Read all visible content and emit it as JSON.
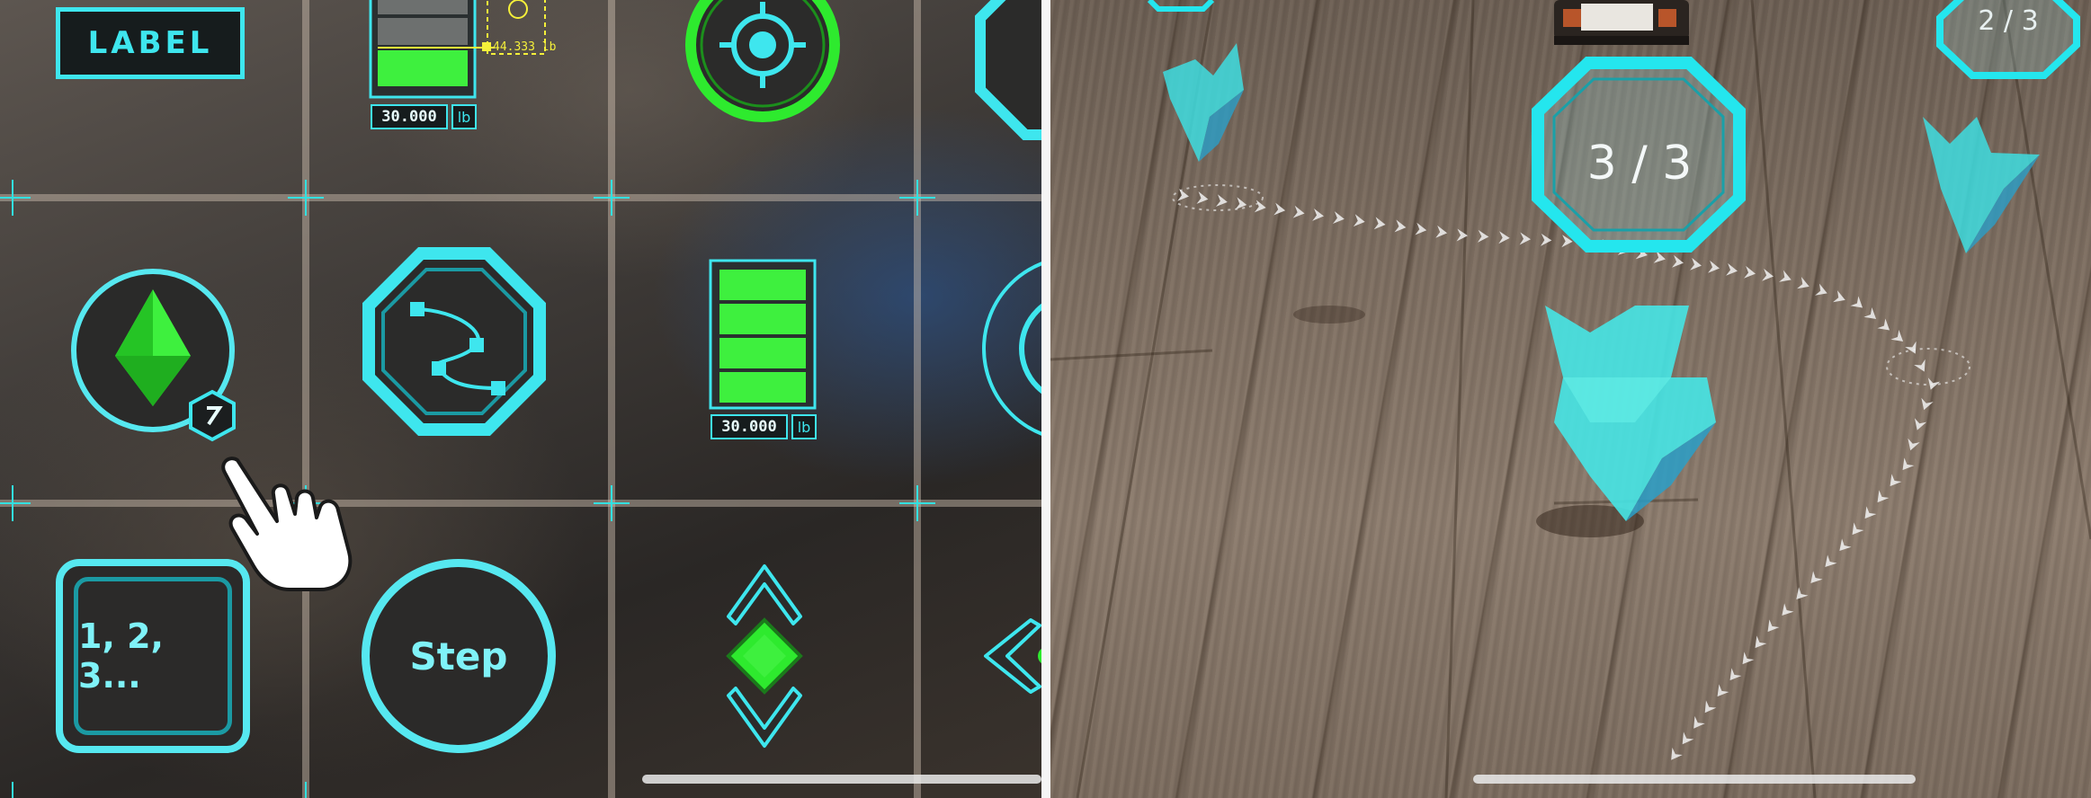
{
  "left": {
    "label_button": "LABEL",
    "weight_readout": "44.333 lb",
    "value_top": "30.000",
    "unit_top": "lb",
    "value_mid": "30.000",
    "unit_mid": "lb",
    "count_button": "1, 2, 3...",
    "step_button": "Step"
  },
  "right": {
    "waypoint_counter": "3 / 3",
    "waypoint_counter_far": "2 / 3"
  },
  "colors": {
    "cyan": "#3ee6ee",
    "green": "#2eea2e",
    "dark": "#161c1d"
  },
  "icons": [
    "crosshair-target-icon",
    "diamond-marker-icon",
    "path-curve-icon",
    "battery-gauge-icon",
    "tap-hand-icon",
    "up-chevron-icon",
    "down-chevron-icon",
    "left-arrow-icon"
  ]
}
